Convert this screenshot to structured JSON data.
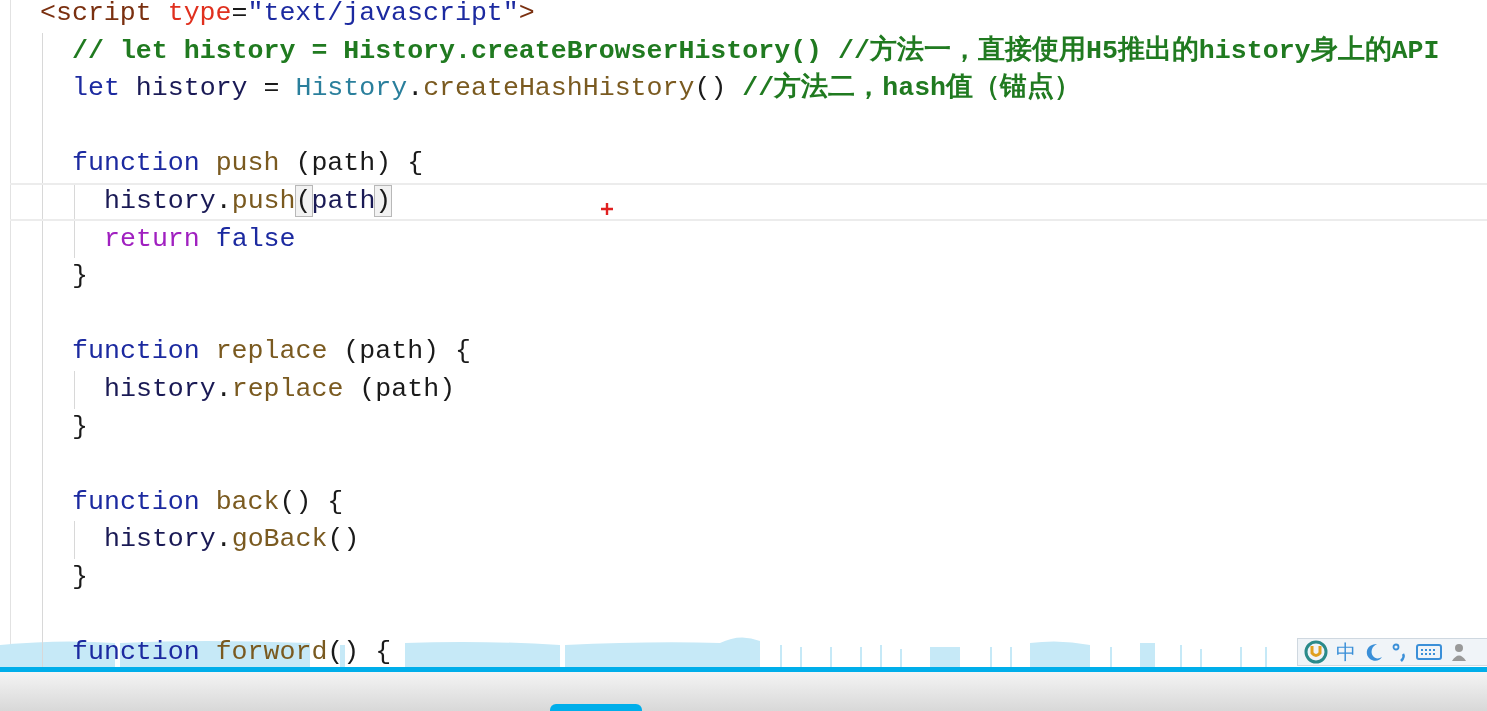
{
  "editor": {
    "lines": [
      {
        "current": false,
        "tokens": [
          {
            "kind": "tag",
            "text": "<script"
          },
          {
            "kind": "attr",
            "text": "type"
          },
          {
            "kind": "punct",
            "text": "="
          },
          {
            "kind": "string",
            "text": "\"text/javascript\""
          },
          {
            "kind": "tag",
            "text": ">"
          }
        ],
        "children": [
          {
            "current": false,
            "tokens": [
              {
                "kind": "comment",
                "text": "// let history = History.createBrowserHistory() //方法一，直接使用H5推出的history身上的API"
              }
            ]
          },
          {
            "current": false,
            "tokens": [
              {
                "kind": "keyword",
                "text": "let"
              },
              {
                "kind": "ident",
                "text": "history"
              },
              {
                "kind": "punct",
                "text": "="
              },
              {
                "kind": "class",
                "text": "History"
              },
              {
                "kind": "punct",
                "text": "."
              },
              {
                "kind": "func",
                "text": "createHashHistory"
              },
              {
                "kind": "punct",
                "text": "()"
              },
              {
                "kind": "comment",
                "text": "//方法二，hash值（锚点）"
              }
            ]
          },
          {
            "current": false
          },
          {
            "current": false,
            "tokens": [
              {
                "kind": "keyword",
                "text": "function"
              },
              {
                "kind": "func",
                "text": "push"
              },
              {
                "kind": "punct",
                "text": "(path) {"
              }
            ],
            "children": [
              {
                "current": true,
                "tokens": [
                  {
                    "kind": "ident",
                    "text": "history"
                  },
                  {
                    "kind": "punct",
                    "text": "."
                  },
                  {
                    "kind": "func",
                    "text": "push"
                  },
                  {
                    "kind": "bracket",
                    "text": "("
                  },
                  {
                    "kind": "ident",
                    "text": "path"
                  },
                  {
                    "kind": "bracket",
                    "text": ")"
                  }
                ]
              },
              {
                "current": false,
                "tokens": [
                  {
                    "kind": "control",
                    "text": "return"
                  },
                  {
                    "kind": "literal",
                    "text": "false"
                  }
                ]
              }
            ]
          },
          {
            "current": false,
            "tokens": [
              {
                "kind": "punct",
                "text": "}"
              }
            ]
          },
          {
            "current": false
          },
          {
            "current": false,
            "tokens": [
              {
                "kind": "keyword",
                "text": "function"
              },
              {
                "kind": "func",
                "text": "replace"
              },
              {
                "kind": "punct",
                "text": "(path) {"
              }
            ],
            "children": [
              {
                "current": false,
                "tokens": [
                  {
                    "kind": "ident",
                    "text": "history"
                  },
                  {
                    "kind": "punct",
                    "text": "."
                  },
                  {
                    "kind": "func",
                    "text": "replace"
                  },
                  {
                    "kind": "punct",
                    "text": "(path)"
                  }
                ]
              }
            ]
          },
          {
            "current": false,
            "tokens": [
              {
                "kind": "punct",
                "text": "}"
              }
            ]
          },
          {
            "current": false
          },
          {
            "current": false,
            "tokens": [
              {
                "kind": "keyword",
                "text": "function"
              },
              {
                "kind": "func",
                "text": "back"
              },
              {
                "kind": "punct",
                "text": "() {"
              }
            ],
            "children": [
              {
                "current": false,
                "tokens": [
                  {
                    "kind": "ident",
                    "text": "history"
                  },
                  {
                    "kind": "punct",
                    "text": "."
                  },
                  {
                    "kind": "func",
                    "text": "goBack"
                  },
                  {
                    "kind": "punct",
                    "text": "()"
                  }
                ]
              }
            ]
          },
          {
            "current": false,
            "tokens": [
              {
                "kind": "punct",
                "text": "}"
              }
            ]
          },
          {
            "current": false
          },
          {
            "current": false,
            "tokens": [
              {
                "kind": "keyword",
                "text": "function"
              },
              {
                "kind": "func",
                "text": "forword"
              },
              {
                "kind": "punct",
                "text": "() {"
              }
            ]
          }
        ]
      }
    ]
  },
  "ime_toolbar": {
    "mode": "中"
  }
}
